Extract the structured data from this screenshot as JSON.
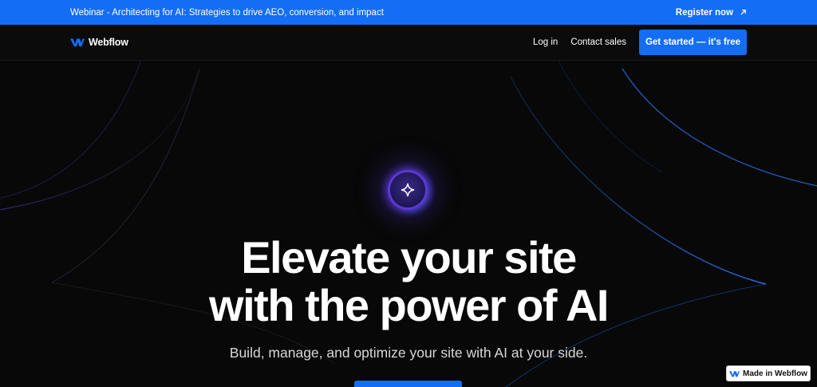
{
  "banner": {
    "text": "Webinar - Architecting for AI: Strategies to drive AEO, conversion, and impact",
    "link_label": "Register now"
  },
  "nav": {
    "brand": "Webflow",
    "login": "Log in",
    "contact": "Contact sales",
    "cta": "Get started — it's free"
  },
  "hero": {
    "headline_line1": "Elevate your site",
    "headline_line2": "with the power of AI",
    "subtitle": "Build, manage, and optimize your site with AI at your side."
  },
  "badge": {
    "label": "Made in Webflow"
  },
  "colors": {
    "accent": "#146ef5",
    "background": "#080808"
  }
}
